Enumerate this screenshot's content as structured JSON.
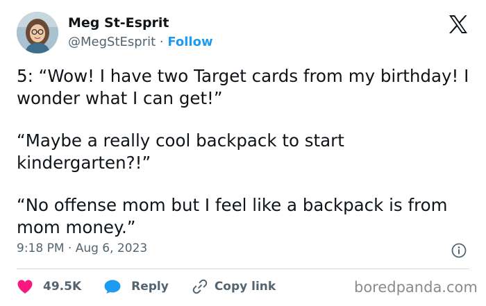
{
  "author": {
    "display_name": "Meg St-Esprit",
    "handle": "@MegStEsprit",
    "separator": " · ",
    "follow_label": "Follow"
  },
  "tweet": {
    "paragraphs": [
      "5: “Wow! I have two Target cards from my birthday! I wonder what I can get!”",
      "“Maybe a really cool backpack to start kindergarten?!”",
      "“No offense mom but I feel like a backpack is from mom money.”"
    ],
    "timestamp": "9:18 PM · Aug 6, 2023"
  },
  "actions": {
    "like_count": "49.5K",
    "reply_label": "Reply",
    "copy_link_label": "Copy link"
  },
  "icons": {
    "logo": "x-logo-icon",
    "info": "info-icon",
    "like": "heart-icon",
    "reply": "speech-bubble-icon",
    "copy": "link-icon"
  },
  "colors": {
    "follow": "#1d9bf0",
    "like": "#f91880",
    "reply": "#1d9bf0",
    "muted": "#536471"
  },
  "watermark": "boredpanda.com"
}
